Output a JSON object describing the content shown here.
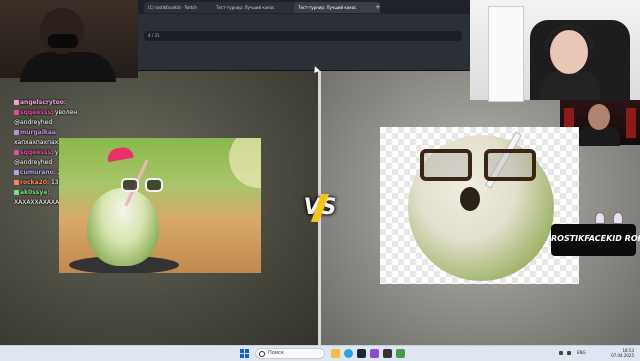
{
  "browser": {
    "tabs": [
      {
        "label": "(1) rostikfacekid - Twitch"
      },
      {
        "label": "Тест-турнир: Лучший кокос"
      },
      {
        "label": "Тест-турнир: Лучший кокос"
      }
    ],
    "new_tab_label": "+",
    "address_text": "4 / 31"
  },
  "chat": {
    "lines": [
      {
        "user": "angelscrytoo",
        "text": "",
        "color": "#f3a6e0"
      },
      {
        "user": "sqqeesss",
        "text": "уволен",
        "color": "#e44aa8"
      },
      {
        "user": "",
        "text": "@andreyhed",
        "color": "#ffffff"
      },
      {
        "user": "murgalkaa",
        "text": "",
        "color": "#c98ae6"
      },
      {
        "user": "",
        "text": "хапхахпахпахпахпах",
        "color": "#ffffff"
      },
      {
        "user": "sqqeesss",
        "text": "уволен",
        "color": "#e44aa8"
      },
      {
        "user": "",
        "text": "@andreyhed",
        "color": "#ffffff"
      },
      {
        "user": "cumurano",
        "text": "ХАХАХАХАХХКК",
        "color": "#b7a3e8"
      },
      {
        "user": "rocka20",
        "text": "139",
        "color": "#ff8a5c"
      },
      {
        "user": "ak0ssya",
        "text": "",
        "color": "#79e08b"
      },
      {
        "user": "",
        "text": "ХАХАХХАХАХАХХХАХАХА",
        "color": "#ffffff"
      }
    ]
  },
  "vs": {
    "label": "VS"
  },
  "streamer_badge": {
    "label": "ROSTIKFACEKID ROFLS"
  },
  "taskbar": {
    "search_placeholder": "Поиск",
    "language": "ENG",
    "time": "18:53",
    "date": "07.04.2025"
  },
  "colors": {
    "accent": "#0a64c8",
    "vs_bolt": "#f5c518",
    "taskbar": "#dfe6ef"
  }
}
